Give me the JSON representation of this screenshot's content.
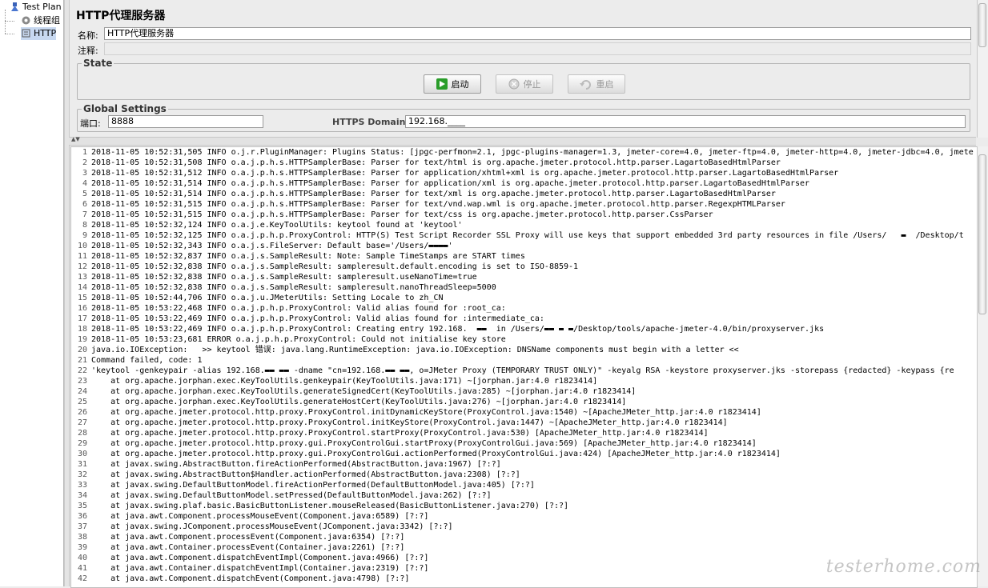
{
  "tree": {
    "root_label": "Test Plan",
    "thread_group_label": "线程组",
    "proxy_label": "HTTP"
  },
  "panel": {
    "title": "HTTP代理服务器",
    "name_label": "名称:",
    "name_value": "HTTP代理服务器",
    "comment_label": "注释:",
    "comment_value": ""
  },
  "state": {
    "legend": "State",
    "start_label": "启动",
    "stop_label": "停止",
    "restart_label": "重启"
  },
  "global": {
    "legend": "Global Settings",
    "port_label": "端口:",
    "port_value": "8888",
    "https_label": "HTTPS Domains:",
    "https_value": "192.168.____"
  },
  "log": {
    "lines": [
      "2018-11-05 10:52:31,505 INFO o.j.r.PluginManager: Plugins Status: [jpgc-perfmon=2.1, jpgc-plugins-manager=1.3, jmeter-core=4.0, jmeter-ftp=4.0, jmeter-http=4.0, jmeter-jdbc=4.0, jmete",
      "2018-11-05 10:52:31,508 INFO o.a.j.p.h.s.HTTPSamplerBase: Parser for text/html is org.apache.jmeter.protocol.http.parser.LagartoBasedHtmlParser",
      "2018-11-05 10:52:31,512 INFO o.a.j.p.h.s.HTTPSamplerBase: Parser for application/xhtml+xml is org.apache.jmeter.protocol.http.parser.LagartoBasedHtmlParser",
      "2018-11-05 10:52:31,514 INFO o.a.j.p.h.s.HTTPSamplerBase: Parser for application/xml is org.apache.jmeter.protocol.http.parser.LagartoBasedHtmlParser",
      "2018-11-05 10:52:31,514 INFO o.a.j.p.h.s.HTTPSamplerBase: Parser for text/xml is org.apache.jmeter.protocol.http.parser.LagartoBasedHtmlParser",
      "2018-11-05 10:52:31,515 INFO o.a.j.p.h.s.HTTPSamplerBase: Parser for text/vnd.wap.wml is org.apache.jmeter.protocol.http.parser.RegexpHTMLParser",
      "2018-11-05 10:52:31,515 INFO o.a.j.p.h.s.HTTPSamplerBase: Parser for text/css is org.apache.jmeter.protocol.http.parser.CssParser",
      "2018-11-05 10:52:32,124 INFO o.a.j.e.KeyToolUtils: keytool found at 'keytool'",
      "2018-11-05 10:52:32,125 INFO o.a.j.p.h.p.ProxyControl: HTTP(S) Test Script Recorder SSL Proxy will use keys that support embedded 3rd party resources in file /Users/   ▬  /Desktop/t",
      "2018-11-05 10:52:32,343 INFO o.a.j.s.FileServer: Default base='/Users/▬▬▬▬'",
      "2018-11-05 10:52:32,837 INFO o.a.j.s.SampleResult: Note: Sample TimeStamps are START times",
      "2018-11-05 10:52:32,838 INFO o.a.j.s.SampleResult: sampleresult.default.encoding is set to ISO-8859-1",
      "2018-11-05 10:52:32,838 INFO o.a.j.s.SampleResult: sampleresult.useNanoTime=true",
      "2018-11-05 10:52:32,838 INFO o.a.j.s.SampleResult: sampleresult.nanoThreadSleep=5000",
      "2018-11-05 10:52:44,706 INFO o.a.j.u.JMeterUtils: Setting Locale to zh_CN",
      "2018-11-05 10:53:22,468 INFO o.a.j.p.h.p.ProxyControl: Valid alias found for :root_ca:",
      "2018-11-05 10:53:22,469 INFO o.a.j.p.h.p.ProxyControl: Valid alias found for :intermediate_ca:",
      "2018-11-05 10:53:22,469 INFO o.a.j.p.h.p.ProxyControl: Creating entry 192.168.  ▬▬  in /Users/▬▬ ▬ ▬/Desktop/tools/apache-jmeter-4.0/bin/proxyserver.jks",
      "2018-11-05 10:53:23,681 ERROR o.a.j.p.h.p.ProxyControl: Could not initialise key store",
      "java.io.IOException:   >> keytool 错误: java.lang.RuntimeException: java.io.IOException: DNSName components must begin with a letter <<",
      "Command failed, code: 1",
      "'keytool -genkeypair -alias 192.168.▬▬ ▬▬ -dname \"cn=192.168.▬▬ ▬▬, o=JMeter Proxy (TEMPORARY TRUST ONLY)\" -keyalg RSA -keystore proxyserver.jks -storepass {redacted} -keypass {re",
      "    at org.apache.jorphan.exec.KeyToolUtils.genkeypair(KeyToolUtils.java:171) ~[jorphan.jar:4.0 r1823414]",
      "    at org.apache.jorphan.exec.KeyToolUtils.generateSignedCert(KeyToolUtils.java:285) ~[jorphan.jar:4.0 r1823414]",
      "    at org.apache.jorphan.exec.KeyToolUtils.generateHostCert(KeyToolUtils.java:276) ~[jorphan.jar:4.0 r1823414]",
      "    at org.apache.jmeter.protocol.http.proxy.ProxyControl.initDynamicKeyStore(ProxyControl.java:1540) ~[ApacheJMeter_http.jar:4.0 r1823414]",
      "    at org.apache.jmeter.protocol.http.proxy.ProxyControl.initKeyStore(ProxyControl.java:1447) ~[ApacheJMeter_http.jar:4.0 r1823414]",
      "    at org.apache.jmeter.protocol.http.proxy.ProxyControl.startProxy(ProxyControl.java:530) [ApacheJMeter_http.jar:4.0 r1823414]",
      "    at org.apache.jmeter.protocol.http.proxy.gui.ProxyControlGui.startProxy(ProxyControlGui.java:569) [ApacheJMeter_http.jar:4.0 r1823414]",
      "    at org.apache.jmeter.protocol.http.proxy.gui.ProxyControlGui.actionPerformed(ProxyControlGui.java:424) [ApacheJMeter_http.jar:4.0 r1823414]",
      "    at javax.swing.AbstractButton.fireActionPerformed(AbstractButton.java:1967) [?:?]",
      "    at javax.swing.AbstractButton$Handler.actionPerformed(AbstractButton.java:2308) [?:?]",
      "    at javax.swing.DefaultButtonModel.fireActionPerformed(DefaultButtonModel.java:405) [?:?]",
      "    at javax.swing.DefaultButtonModel.setPressed(DefaultButtonModel.java:262) [?:?]",
      "    at javax.swing.plaf.basic.BasicButtonListener.mouseReleased(BasicButtonListener.java:270) [?:?]",
      "    at java.awt.Component.processMouseEvent(Component.java:6589) [?:?]",
      "    at javax.swing.JComponent.processMouseEvent(JComponent.java:3342) [?:?]",
      "    at java.awt.Component.processEvent(Component.java:6354) [?:?]",
      "    at java.awt.Container.processEvent(Container.java:2261) [?:?]",
      "    at java.awt.Component.dispatchEventImpl(Component.java:4966) [?:?]",
      "    at java.awt.Container.dispatchEventImpl(Container.java:2319) [?:?]",
      "    at java.awt.Component.dispatchEvent(Component.java:4798) [?:?]"
    ]
  },
  "watermark": "testerhome.com",
  "colors": {
    "start_icon": "#1a8a1a",
    "selection": "#c7d8f0"
  }
}
